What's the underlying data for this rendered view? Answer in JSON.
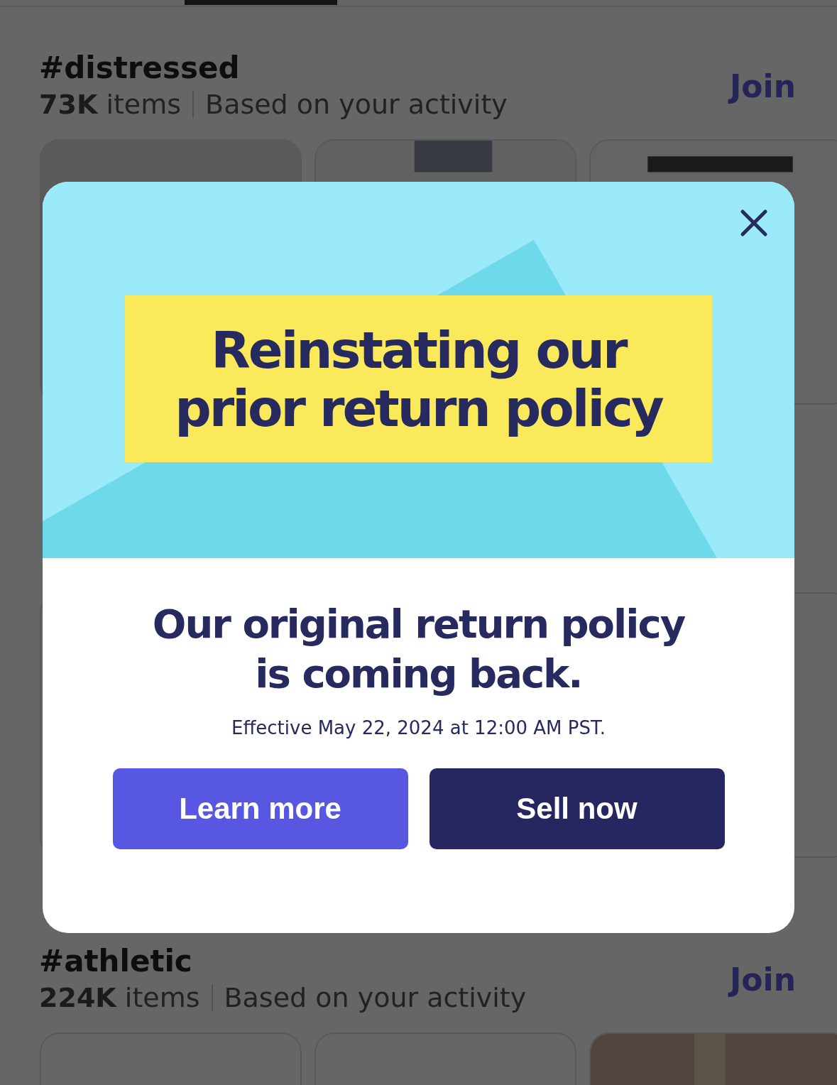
{
  "sections": [
    {
      "tag": "#distressed",
      "count": "73K",
      "unit": "items",
      "reason": "Based on your activity",
      "action": "Join"
    },
    {
      "tag": "#athletic",
      "count": "224K",
      "unit": "items",
      "reason": "Based on your activity",
      "action": "Join"
    }
  ],
  "modal": {
    "banner_title": "Reinstating our\nprior return policy",
    "heading": "Our original return policy\nis coming back.",
    "effective": "Effective May 22, 2024 at 12:00 AM PST.",
    "buttons": [
      {
        "label": "Learn more",
        "kind": "secondary"
      },
      {
        "label": "Sell now",
        "kind": "primary"
      }
    ]
  }
}
